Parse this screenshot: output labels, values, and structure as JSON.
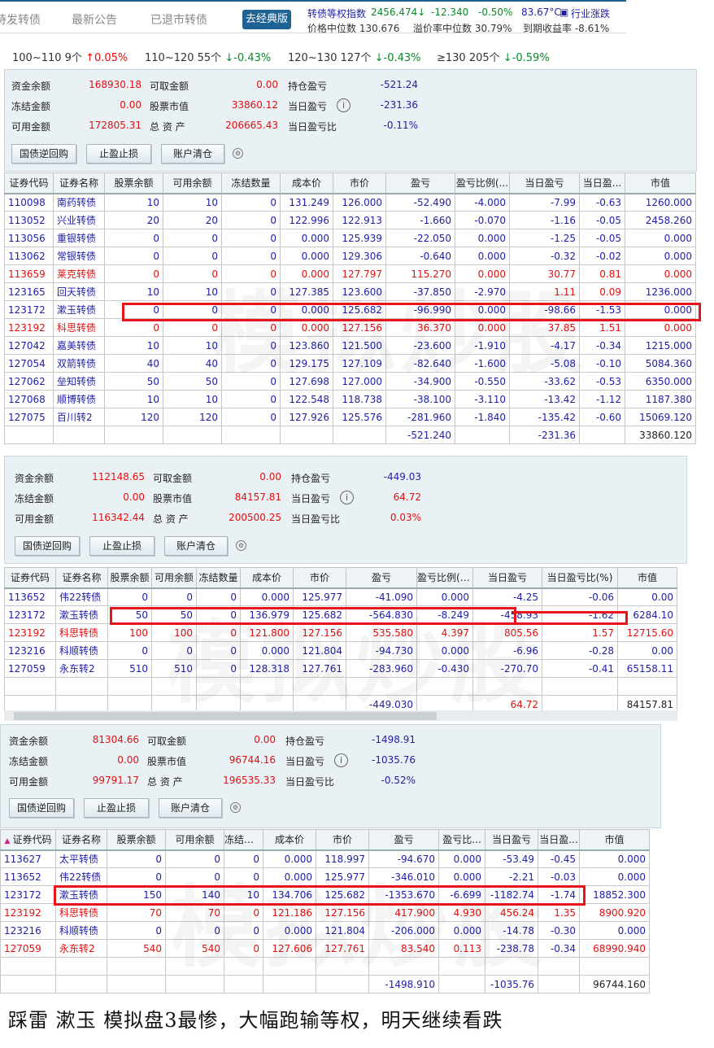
{
  "topbar": {
    "tabs": [
      "待发转债",
      "最新公告",
      "已退市转债"
    ],
    "classic_button": "去经典版",
    "index_label": "转债等权指数",
    "index_value": "2456.474↓",
    "index_change": "-12.340",
    "index_pct": "-0.50%",
    "temperature": "83.67°C",
    "industry_link": "行业涨跌",
    "median_price": "价格中位数 130.676",
    "median_premium": "溢价率中位数 30.79%",
    "ytm": "到期收益率 -8.61%"
  },
  "ranges": [
    {
      "label": "100~110 9个",
      "change": "↑0.05%",
      "dir": "up"
    },
    {
      "label": "110~120 55个",
      "change": "↓-0.43%",
      "dir": "down"
    },
    {
      "label": "120~130 127个",
      "change": "↓-0.43%",
      "dir": "down"
    },
    {
      "label": "≥130 205个",
      "change": "↓-0.59%",
      "dir": "down"
    }
  ],
  "labels": {
    "cash": "资金余额",
    "withdrawable": "可取金额",
    "hold_pl": "持仓盈亏",
    "frozen": "冻结金额",
    "stock_value": "股票市值",
    "day_pl": "当日盈亏",
    "available": "可用金额",
    "total": "总 资 产",
    "day_pl_pct": "当日盈亏比",
    "btn_repo": "国债逆回购",
    "btn_stop": "止盈止损",
    "btn_clear": "账户清仓"
  },
  "watermark": "模拟炒股",
  "colors": {
    "up": "#e01010",
    "down": "#1e1ea8",
    "highlight_box": "#e8141c"
  },
  "accounts": [
    {
      "summary": {
        "cash": "168930.18",
        "withdrawable": "0.00",
        "hold_pl": "-521.24",
        "frozen": "0.00",
        "stock_value": "33860.12",
        "day_pl": "-231.36",
        "available": "172805.31",
        "total": "206665.43",
        "day_pl_pct": "-0.11%"
      },
      "columns": [
        "证券代码",
        "证券名称",
        "股票余额",
        "可用余额",
        "冻结数量",
        "成本价",
        "市价",
        "盈亏",
        "盈亏比例(...",
        "当日盈亏",
        "当日盈...",
        "市值"
      ],
      "rows": [
        [
          "110098",
          "南药转债",
          "10",
          "10",
          "0",
          "131.249",
          "126.000",
          "-52.490",
          "-4.000",
          "-7.99",
          "-0.63",
          "1260.000"
        ],
        [
          "113052",
          "兴业转债",
          "20",
          "20",
          "0",
          "122.996",
          "122.913",
          "-1.660",
          "-0.070",
          "-1.16",
          "-0.05",
          "2458.260"
        ],
        [
          "113056",
          "重银转债",
          "0",
          "0",
          "0",
          "0.000",
          "125.939",
          "-22.050",
          "0.000",
          "-1.25",
          "-0.05",
          "0.000"
        ],
        [
          "113062",
          "常银转债",
          "0",
          "0",
          "0",
          "0.000",
          "129.306",
          "-0.640",
          "0.000",
          "-0.32",
          "-0.02",
          "0.000"
        ],
        [
          "113659",
          "莱克转债",
          "0",
          "0",
          "0",
          "0.000",
          "127.797",
          "115.270",
          "0.000",
          "30.77",
          "0.81",
          "0.000"
        ],
        [
          "123165",
          "回天转债",
          "10",
          "10",
          "0",
          "127.385",
          "123.600",
          "-37.850",
          "-2.970",
          "1.11",
          "0.09",
          "1236.000"
        ],
        [
          "123172",
          "漱玉转债",
          "0",
          "0",
          "0",
          "0.000",
          "125.682",
          "-96.990",
          "0.000",
          "-98.66",
          "-1.53",
          "0.000"
        ],
        [
          "123192",
          "科思转债",
          "0",
          "0",
          "0",
          "0.000",
          "127.156",
          "36.370",
          "0.000",
          "37.85",
          "1.51",
          "0.000"
        ],
        [
          "127042",
          "嘉美转债",
          "10",
          "10",
          "0",
          "123.860",
          "121.500",
          "-23.600",
          "-1.910",
          "-4.17",
          "-0.34",
          "1215.000"
        ],
        [
          "127054",
          "双箭转债",
          "40",
          "40",
          "0",
          "129.175",
          "127.109",
          "-82.640",
          "-1.600",
          "-5.08",
          "-0.10",
          "5084.360"
        ],
        [
          "127062",
          "垒知转债",
          "50",
          "50",
          "0",
          "127.698",
          "127.000",
          "-34.900",
          "-0.550",
          "-33.62",
          "-0.53",
          "6350.000"
        ],
        [
          "127068",
          "顺博转债",
          "10",
          "10",
          "0",
          "122.548",
          "118.738",
          "-38.100",
          "-3.110",
          "-13.42",
          "-1.12",
          "1187.380"
        ],
        [
          "127075",
          "百川转2",
          "120",
          "120",
          "0",
          "127.926",
          "125.576",
          "-281.960",
          "-1.840",
          "-135.42",
          "-0.60",
          "15069.120"
        ]
      ],
      "totals": {
        "pl": "-521.240",
        "day_pl": "-231.36",
        "value": "33860.120"
      }
    },
    {
      "summary": {
        "cash": "112148.65",
        "withdrawable": "0.00",
        "hold_pl": "-449.03",
        "frozen": "0.00",
        "stock_value": "84157.81",
        "day_pl": "64.72",
        "available": "116342.44",
        "total": "200500.25",
        "day_pl_pct": "0.03%"
      },
      "columns": [
        "证券代码",
        "证券名称",
        "股票余额",
        "可用余额",
        "冻结数量",
        "成本价",
        "市价",
        "盈亏",
        "盈亏比例(%)",
        "当日盈亏",
        "当日盈亏比(%)",
        "市值"
      ],
      "rows": [
        [
          "113652",
          "伟22转债",
          "0",
          "0",
          "0",
          "0.000",
          "125.977",
          "-41.090",
          "0.000",
          "-4.25",
          "-0.06",
          "0.00"
        ],
        [
          "123172",
          "漱玉转债",
          "50",
          "50",
          "0",
          "136.979",
          "125.682",
          "-564.830",
          "-8.249",
          "-458.93",
          "-1.62",
          "6284.10"
        ],
        [
          "123192",
          "科思转债",
          "100",
          "100",
          "0",
          "121.800",
          "127.156",
          "535.580",
          "4.397",
          "805.56",
          "1.57",
          "12715.60"
        ],
        [
          "123216",
          "科顺转债",
          "0",
          "0",
          "0",
          "0.000",
          "121.804",
          "-94.730",
          "0.000",
          "-6.96",
          "-0.28",
          "0.00"
        ],
        [
          "127059",
          "永东转2",
          "510",
          "510",
          "0",
          "128.318",
          "127.761",
          "-283.960",
          "-0.430",
          "-270.70",
          "-0.41",
          "65158.11"
        ]
      ],
      "totals": {
        "pl": "-449.030",
        "day_pl": "64.72",
        "value": "84157.81"
      }
    },
    {
      "summary": {
        "cash": "81304.66",
        "withdrawable": "0.00",
        "hold_pl": "-1498.91",
        "frozen": "0.00",
        "stock_value": "96744.16",
        "day_pl": "-1035.76",
        "available": "99791.17",
        "total": "196535.33",
        "day_pl_pct": "-0.52%"
      },
      "columns": [
        "证券代码",
        "证券名称",
        "股票余额",
        "可用余额",
        "冻结数...",
        "成本价",
        "市价",
        "盈亏",
        "盈亏比...",
        "当日盈亏",
        "当日盈...",
        "市值"
      ],
      "sort_indicator": "▲",
      "rows": [
        [
          "113627",
          "太平转债",
          "0",
          "0",
          "0",
          "0.000",
          "118.997",
          "-94.670",
          "0.000",
          "-53.49",
          "-0.45",
          "0.000"
        ],
        [
          "113652",
          "伟22转债",
          "0",
          "0",
          "0",
          "0.000",
          "125.977",
          "-346.010",
          "0.000",
          "-2.21",
          "-0.03",
          "0.000"
        ],
        [
          "123172",
          "漱玉转债",
          "150",
          "140",
          "10",
          "134.706",
          "125.682",
          "-1353.670",
          "-6.699",
          "-1182.74",
          "-1.74",
          "18852.300"
        ],
        [
          "123192",
          "科思转债",
          "70",
          "70",
          "0",
          "121.186",
          "127.156",
          "417.900",
          "4.930",
          "456.24",
          "1.35",
          "8900.920"
        ],
        [
          "123216",
          "科顺转债",
          "0",
          "0",
          "0",
          "0.000",
          "121.804",
          "-206.000",
          "0.000",
          "-14.78",
          "-0.30",
          "0.000"
        ],
        [
          "127059",
          "永东转2",
          "540",
          "540",
          "0",
          "127.606",
          "127.761",
          "83.540",
          "0.113",
          "-238.78",
          "-0.34",
          "68990.940"
        ]
      ],
      "totals": {
        "pl": "-1498.910",
        "day_pl": "-1035.76",
        "value": "96744.160"
      }
    }
  ],
  "caption": "踩雷  漱玉  模拟盘3最惨，大幅跑输等权，明天继续看跌"
}
